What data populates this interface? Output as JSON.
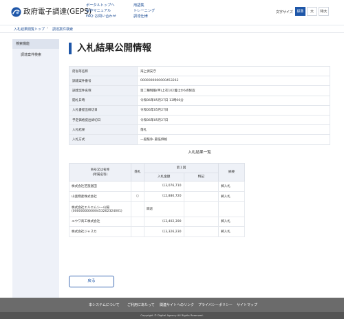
{
  "header": {
    "site_title": "政府電子調達(GEPS)",
    "top_links": [
      "ポータルトップへ",
      "操作マニュアル",
      "FAQ･お問い合わせ",
      "用語集",
      "トレーニング",
      "調達仕様"
    ],
    "font_size_label": "文字サイズ",
    "font_size_options": [
      "標準",
      "大",
      "特大"
    ],
    "font_size_selected": "標準"
  },
  "breadcrumb": [
    "入札結果閲覧トップ",
    "調達案件検索"
  ],
  "sidebar": {
    "heading": "検索機能",
    "items": [
      "調達案件検索"
    ]
  },
  "main": {
    "title": "入札結果公開情報",
    "info_rows": [
      {
        "label": "府省等名称",
        "value": "海上保安庁"
      },
      {
        "label": "調達案件番号",
        "value": "0000000000000453262"
      },
      {
        "label": "調達案件名称",
        "value": "第二種制服(甲)上衣102着ほか6点製造"
      },
      {
        "label": "開札日時",
        "value": "令和06年05月27日 13時00分"
      },
      {
        "label": "入札書提出締切日",
        "value": "令和06年05月27日"
      },
      {
        "label": "予定価格提出締切日",
        "value": "令和06年05月27日"
      },
      {
        "label": "入札結果",
        "value": "落札"
      },
      {
        "label": "入札方式",
        "value": "一般競争･最低価格"
      }
    ],
    "results_title": "入札結果一覧",
    "results_headers": {
      "company": "商号又は名称\n(所属名等)",
      "award": "落札",
      "round": "第１回",
      "amount": "入札金額",
      "note": "特記",
      "remark": "摘要"
    },
    "results": [
      {
        "company": "株式会社芝翫富田",
        "award": "",
        "amount": "\\13,076,710",
        "note": "",
        "remark": "郵入札"
      },
      {
        "company": "山喜物産株式会社",
        "award": "○",
        "amount": "\\12,880,720",
        "note": "",
        "remark": "郵入札"
      },
      {
        "company": "株式会社エルエムシー山陽\n(000000000000453262324001)",
        "award": "",
        "amount": "辞退",
        "note": "",
        "remark": ""
      },
      {
        "company": "ユウワ商工株式会社",
        "award": "",
        "amount": "\\13,402,390",
        "note": "",
        "remark": "郵入札"
      },
      {
        "company": "株式会社ジャスカ",
        "award": "",
        "amount": "\\13,326,230",
        "note": "",
        "remark": "郵入札"
      }
    ],
    "back_label": "戻る"
  },
  "footer": {
    "links": [
      "本システムについて",
      "ご利用にあたって",
      "関連サイトへのリンク",
      "プライバシーポリシー",
      "サイトマップ"
    ],
    "copyright": "Copyright © Digital Agency All Rights Reserved."
  },
  "colors": {
    "accent": "#1e56a8",
    "footer": "#6b6b6b",
    "sidebar": "#eef1f8"
  }
}
